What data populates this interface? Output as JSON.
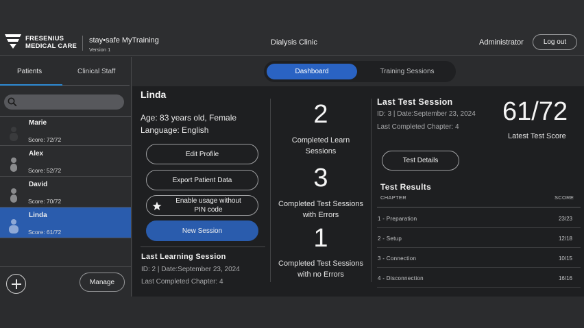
{
  "header": {
    "brand_line1": "FRESENIUS",
    "brand_line2": "MEDICAL CARE",
    "app_title": "stay•safe MyTraining",
    "app_version": "Version 1",
    "clinic": "Dialysis Clinic",
    "user": "Administrator",
    "logout_label": "Log out"
  },
  "sidebar": {
    "tabs": [
      {
        "label": "Patients",
        "active": true
      },
      {
        "label": "Clinical Staff",
        "active": false
      }
    ],
    "search": {
      "placeholder": ""
    },
    "patients": [
      {
        "name": "Marie",
        "score": "Score: 72/72",
        "selected": false
      },
      {
        "name": "Alex",
        "score": "Score: 52/72",
        "selected": false
      },
      {
        "name": "David",
        "score": "Score: 70/72",
        "selected": false
      },
      {
        "name": "Linda",
        "score": "Score: 61/72",
        "selected": true
      }
    ],
    "manage_label": "Manage"
  },
  "top_tabs": [
    {
      "label": "Dashboard",
      "active": true
    },
    {
      "label": "Training Sessions",
      "active": false
    }
  ],
  "patient": {
    "name": "Linda",
    "age": "Age: 83 years old, Female",
    "language": "Language: English",
    "buttons": {
      "edit": "Edit Profile",
      "export": "Export Patient Data",
      "usage_line1": "Enable usage without",
      "usage_line2": "PIN code",
      "new_session": "New Session"
    }
  },
  "last_learning": {
    "title": "Last Learning Session",
    "id_date": "ID: 2 | Date:September 23, 2024",
    "chapter": "Last Completed Chapter: 4"
  },
  "stats": [
    {
      "value": "2",
      "label_line1": "Completed Learn",
      "label_line2": "Sessions"
    },
    {
      "value": "3",
      "label_line1": "Completed Test Sessions",
      "label_line2": "with Errors"
    },
    {
      "value": "1",
      "label_line1": "Completed Test Sessions",
      "label_line2": "with no Errors"
    }
  ],
  "last_test": {
    "title": "Last Test Session",
    "id_date": "ID: 3 | Date:September 23, 2024",
    "chapter": "Last Completed Chapter: 4",
    "score": "61/72",
    "score_label": "Latest Test Score",
    "details_label": "Test Details"
  },
  "test_results": {
    "title": "Test Results",
    "col_chapter": "CHAPTER",
    "col_score": "SCORE",
    "rows": [
      {
        "chapter": "1 - Preparation",
        "score": "23/23"
      },
      {
        "chapter": "2 - Setup",
        "score": "12/18"
      },
      {
        "chapter": "3 - Connection",
        "score": "10/15"
      },
      {
        "chapter": "4 - Disconnection",
        "score": "16/16"
      }
    ]
  },
  "colors": {
    "accent": "#2a5cad",
    "tab_active": "#2a63c3",
    "underline": "#2e8bd6",
    "panel": "#1e1f21",
    "background": "#2b2c2e"
  }
}
